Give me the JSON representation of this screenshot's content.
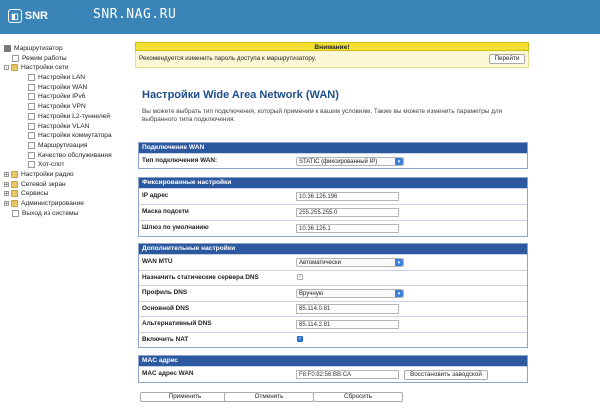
{
  "header": {
    "logo_text": "SNR",
    "site": "SNR.NAG.RU"
  },
  "nav": [
    {
      "label": "Маршрутизатор",
      "icon": "computer-icon",
      "level": 0
    },
    {
      "label": "Режим работы",
      "icon": "page-icon",
      "level": 1
    },
    {
      "label": "Настройки сети",
      "icon": "folder-icon",
      "level": 0,
      "expander": "-"
    },
    {
      "label": "Настройки LAN",
      "icon": "page-icon",
      "level": 2
    },
    {
      "label": "Настройки WAN",
      "icon": "page-icon",
      "level": 2
    },
    {
      "label": "Настройки IPv6",
      "icon": "page-icon",
      "level": 2
    },
    {
      "label": "Настройки VPN",
      "icon": "page-icon",
      "level": 2
    },
    {
      "label": "Настройки L2-туннелей",
      "icon": "page-icon",
      "level": 2
    },
    {
      "label": "Настройки VLAN",
      "icon": "page-icon",
      "level": 2
    },
    {
      "label": "Настройки коммутатора",
      "icon": "page-icon",
      "level": 2
    },
    {
      "label": "Маршрутизация",
      "icon": "page-icon",
      "level": 2
    },
    {
      "label": "Качество обслуживания",
      "icon": "page-icon",
      "level": 2
    },
    {
      "label": "Хот-спот",
      "icon": "page-icon",
      "level": 2
    },
    {
      "label": "Настройки радио",
      "icon": "folder-icon",
      "level": 0,
      "expander": "+"
    },
    {
      "label": "Сетевой экран",
      "icon": "folder-icon",
      "level": 0,
      "expander": "+"
    },
    {
      "label": "Сервисы",
      "icon": "folder-icon",
      "level": 0,
      "expander": "+"
    },
    {
      "label": "Администрирование",
      "icon": "folder-icon",
      "level": 0,
      "expander": "+"
    },
    {
      "label": "Выход из системы",
      "icon": "page-icon",
      "level": 1
    }
  ],
  "warning": {
    "title": "Внимание!",
    "text": "Рекомендуется изменить пароль доступа к маршрутизатору.",
    "button": "Перейти"
  },
  "page": {
    "title": "Настройки Wide Area Network (WAN)",
    "description": "Вы можете выбрать тип подключения, который применим к вашим условиям. Также вы можете изменить параметры для выбранного типа подключения."
  },
  "sections": {
    "connection": {
      "title": "Подключение WAN",
      "type_label": "Тип подключения WAN:",
      "type_value": "STATIC (фиксированный IP)"
    },
    "fixed": {
      "title": "Фиксированные настройки",
      "ip_label": "IP адрес",
      "ip_value": "10.36.126.196",
      "mask_label": "Маска подсети",
      "mask_value": "255.255.255.0",
      "gw_label": "Шлюз по умолчанию",
      "gw_value": "10.36.126.1"
    },
    "additional": {
      "title": "Дополнительные настройки",
      "mtu_label": "WAN MTU",
      "mtu_value": "Автоматически",
      "static_dns_label": "Назначить статические сервера DNS",
      "static_dns_checked": true,
      "dns_profile_label": "Профиль DNS",
      "dns_profile_value": "Вручную",
      "dns1_label": "Основной DNS",
      "dns1_value": "85.114.0.81",
      "dns2_label": "Альтернативный DNS",
      "dns2_value": "85.114.2.81",
      "nat_label": "Включить NAT",
      "nat_checked": true
    },
    "mac": {
      "title": "MAC адрес",
      "mac_label": "MAC адрес WAN",
      "mac_value": "F8:F0:82:56:BB:CA",
      "restore_button": "Восстановить заводской"
    }
  },
  "actions": {
    "apply": "Применить",
    "cancel": "Отменить",
    "reset": "Сбросить"
  },
  "colors": {
    "topbar": "#3a84b8",
    "section_header": "#2c58a0",
    "title": "#1f4f8c",
    "warning": "#f2e034"
  }
}
